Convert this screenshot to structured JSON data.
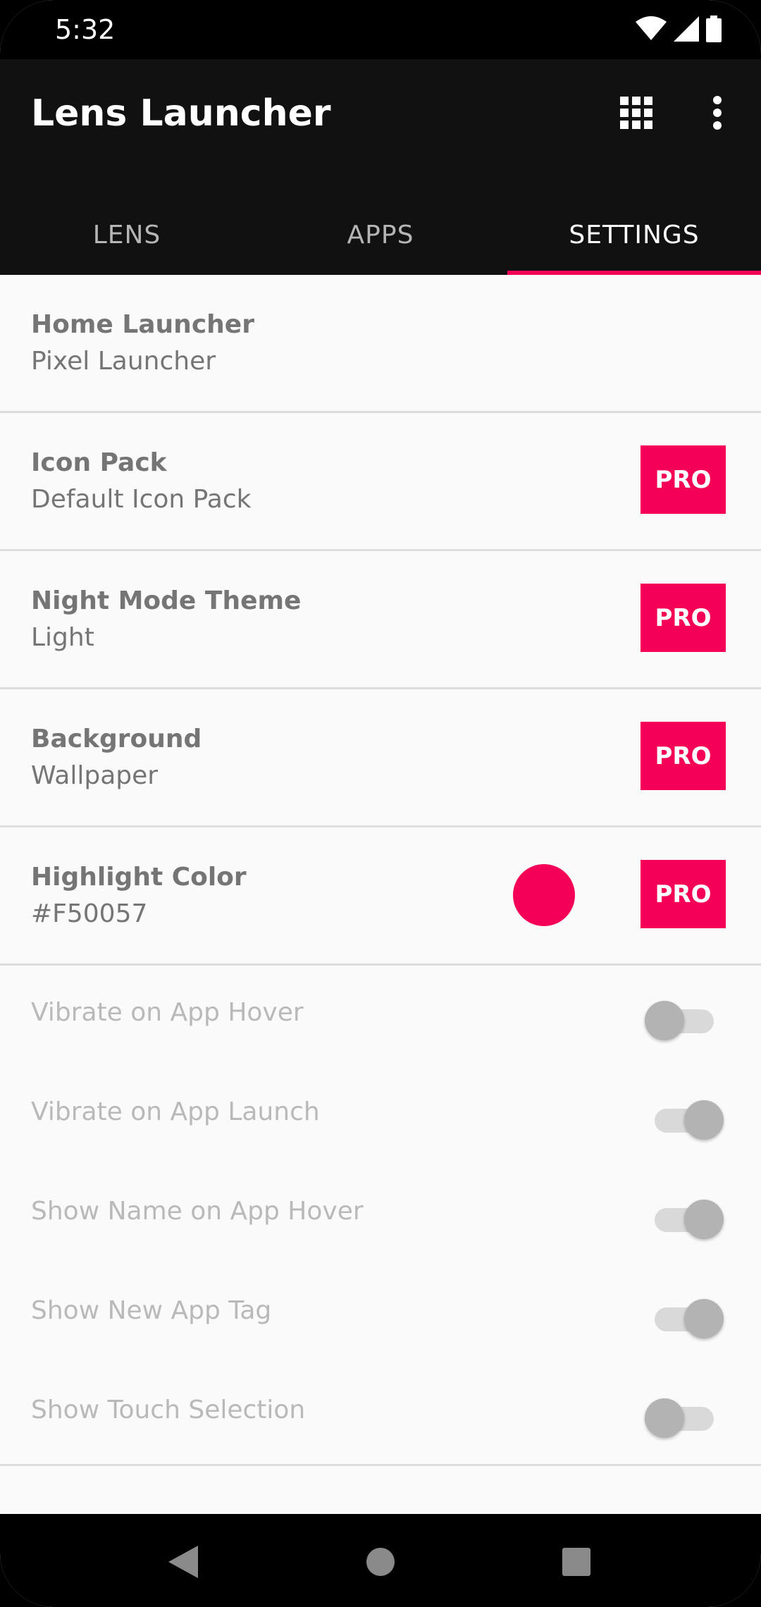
{
  "status_bar": {
    "time": "5:32",
    "icons": [
      "wifi-icon",
      "cell-signal-icon",
      "battery-icon"
    ]
  },
  "app_bar": {
    "title": "Lens Launcher",
    "actions": [
      "apps-grid-icon",
      "more-vert-icon"
    ]
  },
  "tabs": [
    {
      "label": "LENS",
      "active": false
    },
    {
      "label": "APPS",
      "active": false
    },
    {
      "label": "SETTINGS",
      "active": true
    }
  ],
  "settings": [
    {
      "title": "Home Launcher",
      "value": "Pixel Launcher",
      "pro": false
    },
    {
      "title": "Icon Pack",
      "value": "Default Icon Pack",
      "pro": true
    },
    {
      "title": "Night Mode Theme",
      "value": "Light",
      "pro": true
    },
    {
      "title": "Background",
      "value": "Wallpaper",
      "pro": true
    },
    {
      "title": "Highlight Color",
      "value": "#F50057",
      "pro": true,
      "swatch_color": "#F50057"
    }
  ],
  "pro_label": "PRO",
  "toggles": [
    {
      "label": "Vibrate on App Hover",
      "on": false
    },
    {
      "label": "Vibrate on App Launch",
      "on": true
    },
    {
      "label": "Show Name on App Hover",
      "on": true
    },
    {
      "label": "Show New App Tag",
      "on": true
    },
    {
      "label": "Show Touch Selection",
      "on": false
    }
  ],
  "colors": {
    "accent": "#f50057",
    "app_bar": "#111111",
    "background": "#fafafa"
  },
  "nav_bar": [
    "back-icon",
    "home-icon",
    "recents-icon"
  ]
}
